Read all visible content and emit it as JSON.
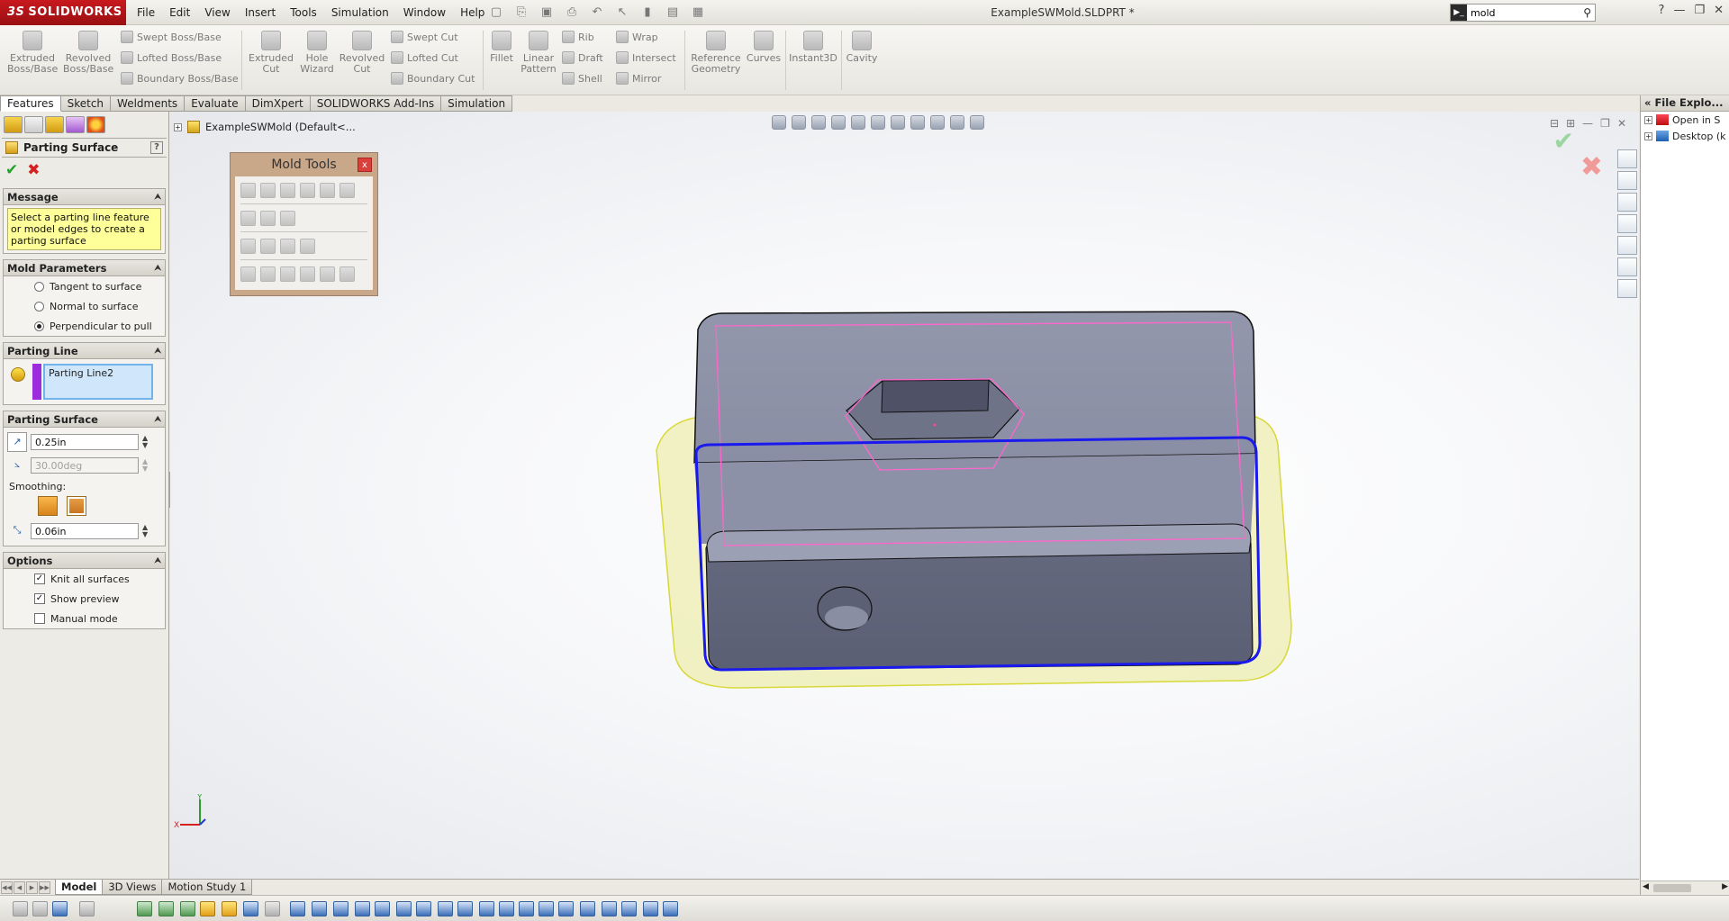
{
  "app": {
    "logo_prefix": "3S",
    "logo_text": "SOLIDWORKS",
    "menu": [
      "File",
      "Edit",
      "View",
      "Insert",
      "Tools",
      "Simulation",
      "Window",
      "Help"
    ],
    "document_title": "ExampleSWMold.SLDPRT *",
    "search": {
      "value": "mold",
      "cmd_glyph": "▶_"
    }
  },
  "command_manager": {
    "large_buttons": [
      {
        "label": "Extruded\nBoss/Base"
      },
      {
        "label": "Revolved\nBoss/Base"
      },
      {
        "label": "Extruded\nCut"
      },
      {
        "label": "Hole\nWizard"
      },
      {
        "label": "Revolved\nCut"
      },
      {
        "label": "Fillet"
      },
      {
        "label": "Linear\nPattern"
      },
      {
        "label": "Reference\nGeometry"
      },
      {
        "label": "Curves"
      },
      {
        "label": "Instant3D"
      },
      {
        "label": "Cavity"
      }
    ],
    "small_buttons": [
      "Swept Boss/Base",
      "Lofted Boss/Base",
      "Boundary Boss/Base",
      "Swept Cut",
      "Lofted Cut",
      "Boundary Cut",
      "Rib",
      "Draft",
      "Shell",
      "Wrap",
      "Intersect",
      "Mirror"
    ],
    "tabs": [
      {
        "label": "Features",
        "active": true
      },
      {
        "label": "Sketch"
      },
      {
        "label": "Weldments"
      },
      {
        "label": "Evaluate"
      },
      {
        "label": "DimXpert"
      },
      {
        "label": "SOLIDWORKS Add-Ins"
      },
      {
        "label": "Simulation"
      }
    ]
  },
  "property_manager": {
    "title": "Parting Surface",
    "help": "?",
    "ok_glyph": "✔",
    "cancel_glyph": "✖",
    "message": {
      "title": "Message",
      "text": "Select a parting line feature or model edges to create a parting surface"
    },
    "mold_parameters": {
      "title": "Mold Parameters",
      "options": [
        {
          "label": "Tangent to surface",
          "selected": false
        },
        {
          "label": "Normal to surface",
          "selected": false
        },
        {
          "label": "Perpendicular to pull",
          "selected": true
        }
      ]
    },
    "parting_line": {
      "title": "Parting Line",
      "items": [
        "Parting Line2"
      ],
      "color": "#9b2ddf"
    },
    "parting_surface": {
      "title": "Parting Surface",
      "distance": "0.25in",
      "angle": "30.00deg",
      "smoothing_label": "Smoothing:",
      "smoothing_distance": "0.06in"
    },
    "options": {
      "title": "Options",
      "checks": [
        {
          "label": "Knit all surfaces",
          "checked": true
        },
        {
          "label": "Show preview",
          "checked": true
        },
        {
          "label": "Manual mode",
          "checked": false
        }
      ]
    }
  },
  "tree": {
    "root_label": "ExampleSWMold  (Default<..."
  },
  "mold_tools": {
    "title": "Mold Tools",
    "close_glyph": "x"
  },
  "task_pane": {
    "title": "File Explo...",
    "items": [
      "Open in S",
      "Desktop (k"
    ]
  },
  "bottom_tabs": [
    {
      "label": "Model",
      "active": true
    },
    {
      "label": "3D Views"
    },
    {
      "label": "Motion Study 1"
    }
  ],
  "triad": {
    "x_label": "X",
    "y_label": "Y"
  },
  "colors": {
    "part_body": "#8b8fa3",
    "parting_line": "#1a1aee",
    "surface_preview": "#eeeeaa",
    "pull_edges": "#ff66cc"
  }
}
